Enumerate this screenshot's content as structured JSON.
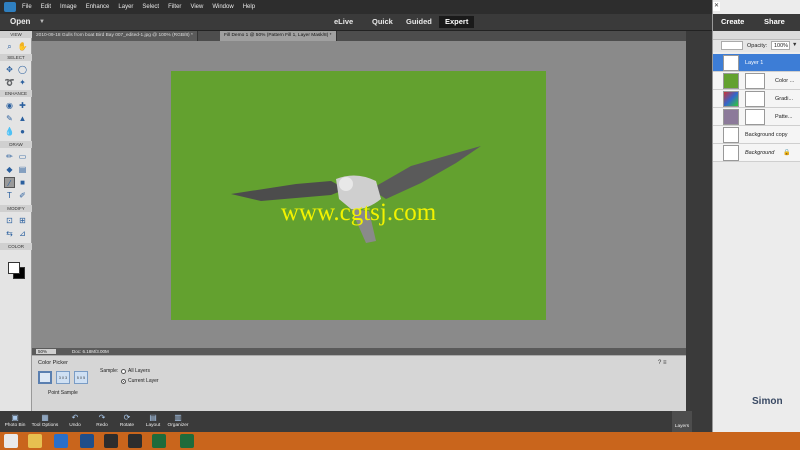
{
  "menu": [
    "File",
    "Edit",
    "Image",
    "Enhance",
    "Layer",
    "Select",
    "Filter",
    "View",
    "Window",
    "Help"
  ],
  "modebar": {
    "open_label": "Open",
    "modes": [
      "eLive",
      "Quick",
      "Guided",
      "Expert"
    ],
    "active_mode": "Expert"
  },
  "right_panel": {
    "create_label": "Create",
    "share_label": "Share",
    "opacity_label": "Opacity:",
    "opacity_value": "100%",
    "layers": [
      {
        "name": "Layer 1",
        "selected": true
      },
      {
        "name": "Color ...",
        "selected": false
      },
      {
        "name": "Gradi...",
        "selected": false
      },
      {
        "name": "Patte...",
        "selected": false
      },
      {
        "name": "Background copy",
        "selected": false
      },
      {
        "name": "Background",
        "selected": false
      }
    ]
  },
  "toolbox": {
    "sections": [
      "VIEW",
      "SELECT",
      "ENHANCE",
      "DRAW",
      "MODIFY",
      "COLOR"
    ]
  },
  "document_tabs": [
    {
      "label": "2010-09-18 Gulls from boat Bird Bay 007_edited-1.jpg @ 100% (RGB/8) *",
      "active": false
    },
    {
      "label": "Fill Demo 1 @ 50% (Pattern Fill 1, Layer Mask/8) *",
      "active": true
    }
  ],
  "canvas": {
    "image_color": "#63a12f",
    "watermark": "www.cgtsj.com"
  },
  "status": {
    "zoom": "50%",
    "doc_size": "Doc: 6.18M/3.00M"
  },
  "tool_options": {
    "title": "Color Picker",
    "sample_sizes": [
      "",
      "3 X 3",
      "5 X 5"
    ],
    "sample_label": "Point Sample",
    "sample_heading": "Sample:",
    "radio_all": "All Layers",
    "radio_current": "Current Layer"
  },
  "actionbar": {
    "items": [
      "Photo Bin",
      "Tool Options",
      "Undo",
      "Redo",
      "Rotate",
      "Layout",
      "Organizer"
    ],
    "layers_tab": "Layers"
  },
  "corner_logo_text": "Simon"
}
